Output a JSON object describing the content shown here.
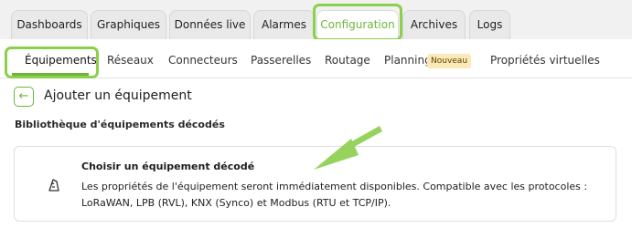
{
  "main_tabs": [
    {
      "label": "Dashboards"
    },
    {
      "label": "Graphiques"
    },
    {
      "label": "Données live"
    },
    {
      "label": "Alarmes"
    },
    {
      "label": "Configuration"
    },
    {
      "label": "Archives"
    },
    {
      "label": "Logs"
    }
  ],
  "sub_tabs": [
    {
      "label": "Équipements"
    },
    {
      "label": "Réseaux"
    },
    {
      "label": "Connecteurs"
    },
    {
      "label": "Passerelles"
    },
    {
      "label": "Routage"
    },
    {
      "label": "Planning",
      "badge": "Nouveau"
    },
    {
      "label": "Propriétés virtuelles"
    }
  ],
  "page": {
    "title": "Ajouter un équipement",
    "back_icon": "arrow-left-icon"
  },
  "library": {
    "section_label": "Bibliothèque d'équipements décodés",
    "card": {
      "icon": "device-icon",
      "title": "Choisir un équipement décodé",
      "description": "Les propriétés de l'équipement seront immédiatement disponibles. Compatible avec les protocoles : LoRaWAN, LPB (RVL), KNX (Synco) et Modbus (RTU et TCP/IP)."
    }
  },
  "colors": {
    "accent_green": "#6fb53a",
    "highlight_green": "#8bd04b",
    "badge_bg": "#fbe9b8"
  }
}
